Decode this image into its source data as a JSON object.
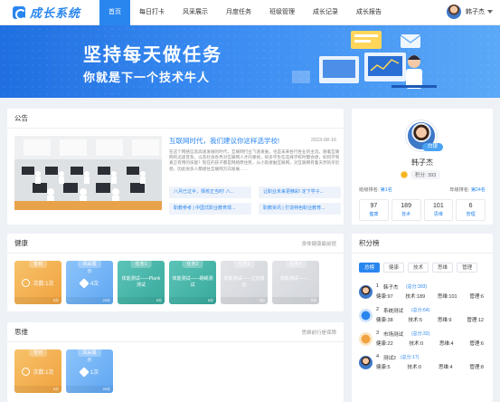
{
  "app": {
    "title": "成长系统"
  },
  "nav": {
    "items": [
      "首页",
      "每日打卡",
      "风采展示",
      "月度任务",
      "班级管理",
      "成长记录",
      "成长报告"
    ],
    "active_index": 0
  },
  "user": {
    "name": "韩子杰"
  },
  "banner": {
    "headline": "坚持每天做任务",
    "subline": "你就是下一个技术牛人"
  },
  "notice": {
    "title": "公告",
    "headline": "互联网时代，我们建议你这样选学校!",
    "date": "2023-08-16",
    "body": "在这个网络信息高速发展的时代，互联网行业飞速发展，也是未来各行各业的主流。随着互联网的迅速普及，以及社会各界对互联网人才的重视，很多学生在选择学校时都会想，如何学到真正有用的技能？现在的孩子都是网络原住民，从小就接触互联网，对互联网有着天然的亲近感，因此很多人都想往互联网方向发展……",
    "links": [
      "八月已过半，择校正当时! 八...",
      "让职业未来更精彩! 定下学子...",
      "职教参考 | 中国式职业教育现...",
      "职教资讯 | 打造特色职业教育..."
    ]
  },
  "health": {
    "title": "健康",
    "sub": "身体健康最前提",
    "tiles": [
      {
        "tag": "签到",
        "value": "次数:1次",
        "score": "5分",
        "color": "orange",
        "icon": "clock-icon"
      },
      {
        "tag": "风采展示",
        "value": "4次",
        "score": "20分",
        "color": "blue",
        "icon": "diamond-icon"
      },
      {
        "tag": "任务1",
        "value": "体能测试——Plank测试",
        "score": "5分",
        "color": "teal",
        "icon": ""
      },
      {
        "tag": "任务2",
        "value": "体能测试——跳绳测试",
        "score": "5分",
        "color": "teal",
        "icon": ""
      },
      {
        "tag": "任务3",
        "value": "体能测试——立定跳远",
        "score": "5分",
        "color": "gray",
        "icon": ""
      },
      {
        "tag": "任务4",
        "value": "体能测试——...",
        "score": "5分",
        "color": "gray",
        "icon": ""
      }
    ]
  },
  "mind": {
    "title": "思维",
    "sub": "思维前行是保障",
    "tiles": [
      {
        "tag": "签到",
        "value": "次数:1次",
        "score": "5分",
        "color": "orange",
        "icon": "clock-icon"
      },
      {
        "tag": "风采展示",
        "value": "1次",
        "score": "20分",
        "color": "blue",
        "icon": "diamond-icon"
      }
    ]
  },
  "profile": {
    "badge": "白银",
    "name": "韩子杰",
    "score_label": "积分: 393",
    "class_rank_label": "班级排名:",
    "class_rank": "第1名",
    "grade_rank_label": "年级排名:",
    "grade_rank": "第24名",
    "stats": [
      {
        "value": "97",
        "label": "健康"
      },
      {
        "value": "189",
        "label": "技术"
      },
      {
        "value": "101",
        "label": "思维"
      },
      {
        "value": "6",
        "label": "管理"
      }
    ]
  },
  "leaderboard": {
    "title": "积分榜",
    "tabs": [
      "总榜",
      "健康",
      "技术",
      "思维",
      "管理"
    ],
    "active_tab": 0,
    "rows": [
      {
        "rank": "1",
        "name": "韩子杰",
        "points": "(总分:393)",
        "health": "健康:97",
        "tech": "技术:189",
        "mind": "思维:101",
        "mgmt": "管理:6"
      },
      {
        "rank": "2",
        "name": "系统测试",
        "points": "(总分:64)",
        "health": "健康:38",
        "tech": "技术:5",
        "mind": "思维:9",
        "mgmt": "管理:12"
      },
      {
        "rank": "3",
        "name": "市场测试",
        "points": "(总分:32)",
        "health": "健康:22",
        "tech": "技术:0",
        "mind": "思维:4",
        "mgmt": "管理:6"
      },
      {
        "rank": "4",
        "name": "测试2",
        "points": "(总分:17)",
        "health": "健康:5",
        "tech": "技术:0",
        "mind": "思维:4",
        "mgmt": "管理:8"
      }
    ]
  },
  "colors": {
    "primary": "#2a86ef",
    "orange": "#f0a23e",
    "blue": "#5ea6f2",
    "teal": "#38aa9d",
    "gray": "#d2d5da"
  }
}
